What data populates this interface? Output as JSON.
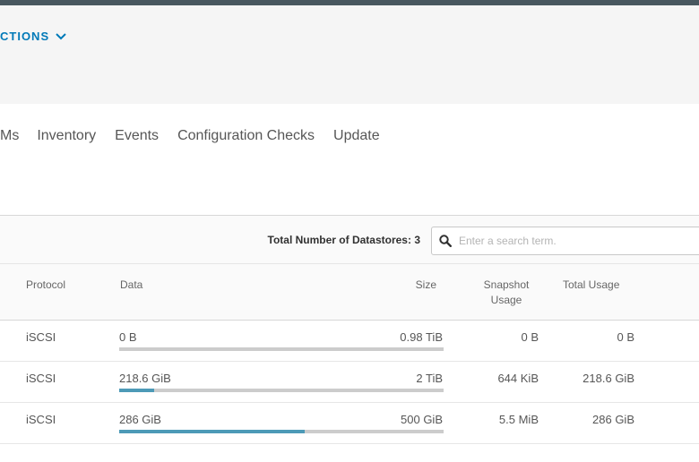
{
  "header": {
    "actions_label": "CTIONS"
  },
  "tabs": [
    {
      "label": "Ms"
    },
    {
      "label": "Inventory"
    },
    {
      "label": "Events"
    },
    {
      "label": "Configuration Checks"
    },
    {
      "label": "Update"
    }
  ],
  "toolbar": {
    "total_label": "Total Number of Datastores: 3",
    "search_placeholder": "Enter a search term."
  },
  "table": {
    "columns": {
      "protocol": "Protocol",
      "data": "Data",
      "size": "Size",
      "snapshot_line1": "Snapshot",
      "snapshot_line2": "Usage",
      "total": "Total Usage"
    },
    "rows": [
      {
        "protocol": "iSCSI",
        "data": "0 B",
        "size": "0.98 TiB",
        "snapshot": "0 B",
        "total": "0 B",
        "usage_fraction": 0.0
      },
      {
        "protocol": "iSCSI",
        "data": "218.6 GiB",
        "size": "2 TiB",
        "snapshot": "644 KiB",
        "total": "218.6 GiB",
        "usage_fraction": 0.107
      },
      {
        "protocol": "iSCSI",
        "data": "286 GiB",
        "size": "500 GiB",
        "snapshot": "5.5 MiB",
        "total": "286 GiB",
        "usage_fraction": 0.572
      }
    ]
  },
  "colors": {
    "accent": "#0079b8",
    "usage_bar": "#4d9ab7",
    "bar_track": "#cccccc"
  }
}
